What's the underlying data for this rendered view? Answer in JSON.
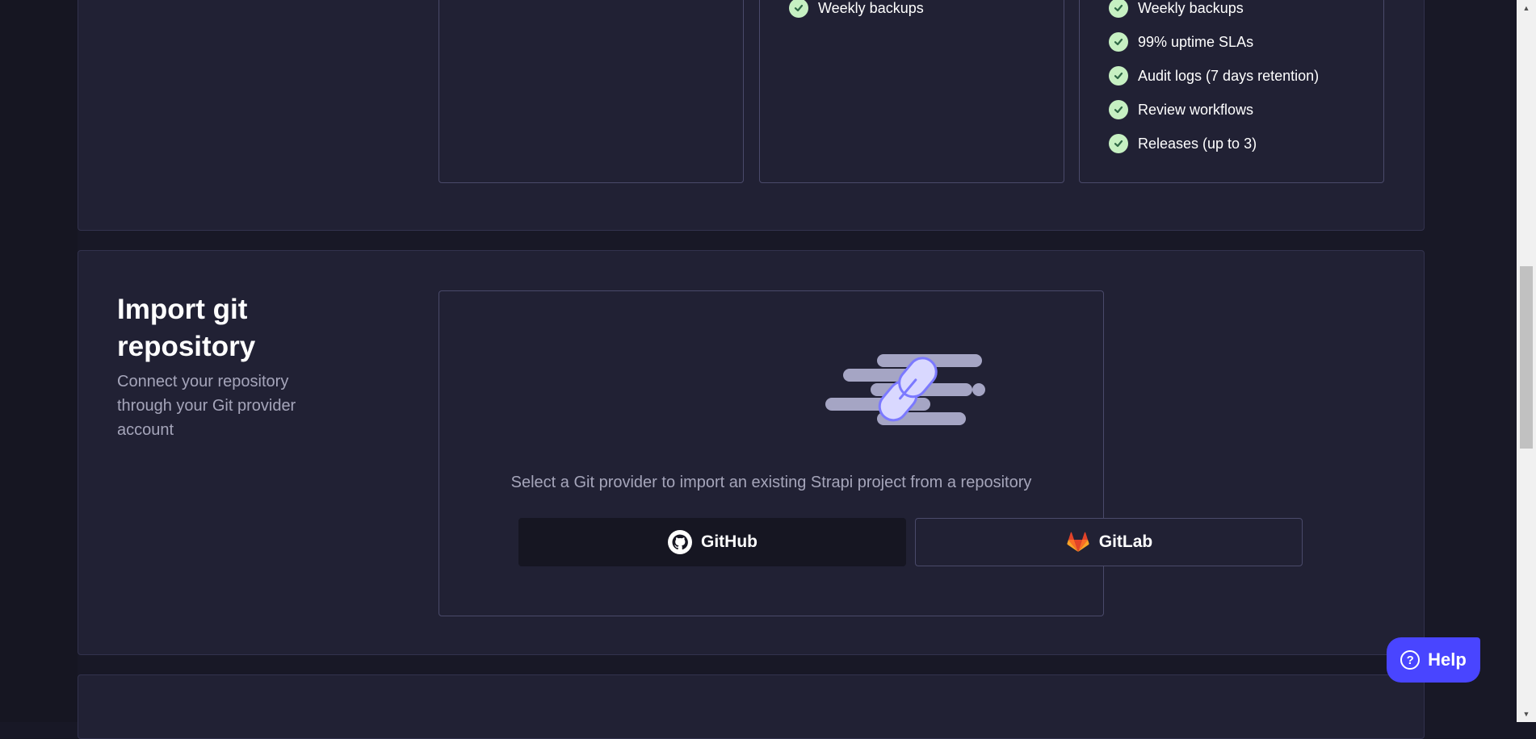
{
  "plans": {
    "card_2_features": [
      "Weekly backups"
    ],
    "card_3_features": [
      "Weekly backups",
      "99% uptime SLAs",
      "Audit logs (7 days retention)",
      "Review workflows",
      "Releases (up to 3)"
    ],
    "check_color": "#c6f0c2"
  },
  "import_section": {
    "title": "Import git repository",
    "description": "Connect your repository through your Git provider account",
    "hint": "Select a Git provider to import an existing Strapi project from a repository",
    "github_label": "GitHub",
    "gitlab_label": "GitLab"
  },
  "help": {
    "label": "Help"
  },
  "colors": {
    "background": "#181826",
    "surface": "#212134",
    "border": "#4a4a6a",
    "accent": "#4945ff",
    "muted_text": "#a5a5ba"
  }
}
